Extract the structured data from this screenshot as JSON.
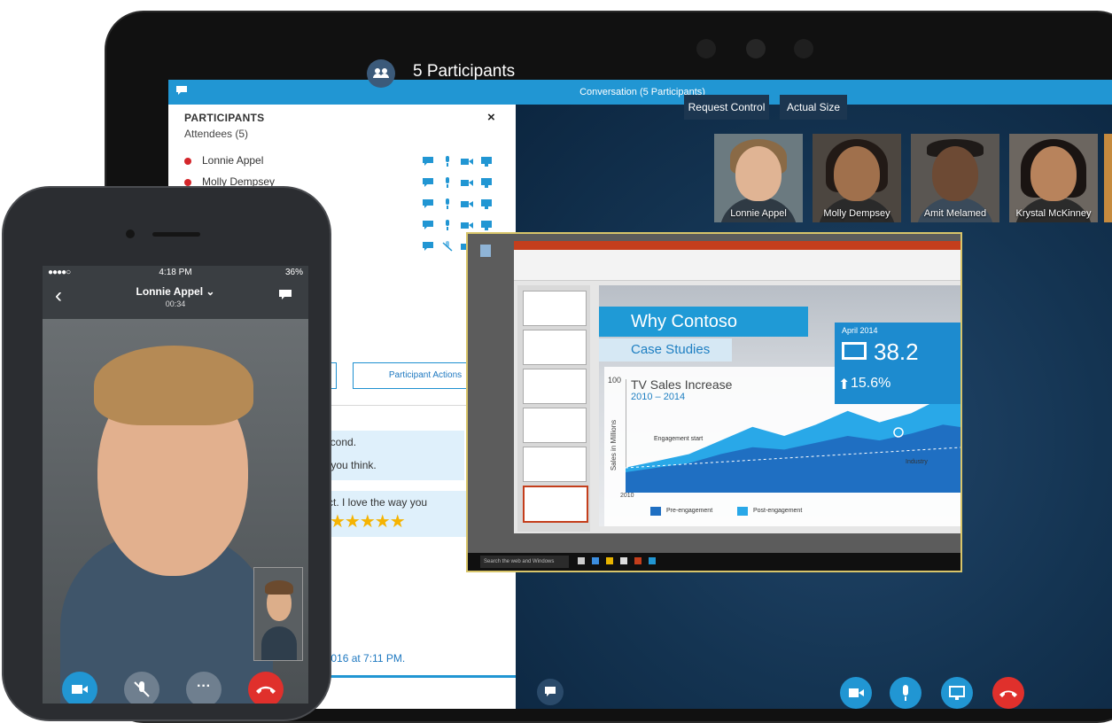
{
  "window": {
    "title": "Conversation (5 Participants)"
  },
  "left_panel": {
    "participants_header": "PARTICIPANTS",
    "attendees_label": "Attendees (5)",
    "close_symbol": "×",
    "participants": [
      {
        "name": "Lonnie Appel"
      },
      {
        "name": "Molly Dempsey"
      }
    ],
    "participant_actions_label": "Participant Actions"
  },
  "chat": {
    "close_symbol": "×",
    "messages": [
      {
        "lines": [
          "second.",
          "at you think."
        ]
      },
      {
        "lines": [
          "fect. I love the way you",
          "t."
        ],
        "stars": "★★★★★"
      }
    ],
    "date_line": "23/2016 at 7:11 PM."
  },
  "stage": {
    "title": "5 Participants",
    "request_control_label": "Request Control",
    "actual_size_label": "Actual Size",
    "tiles": [
      {
        "name": "Lonnie Appel"
      },
      {
        "name": "Molly Dempsey"
      },
      {
        "name": "Amit Melamed"
      },
      {
        "name": "Krystal McKinney"
      }
    ]
  },
  "shared_slide": {
    "title": "Why Contoso",
    "subtitle": "Case Studies",
    "stat_date": "April 2014",
    "stat_value": "38.2",
    "stat_percent": "15.6%",
    "taskbar_search": "Search the web and Windows"
  },
  "chart_data": {
    "type": "area",
    "title": "TV Sales Increase",
    "subtitle": "2010 – 2014",
    "ylabel": "Sales in Millions",
    "ylim": [
      0,
      100
    ],
    "y_tick_top": "100",
    "x_first_label": "2010",
    "annotation": "Engagement start",
    "series": [
      {
        "name": "Pre-engagement",
        "values": [
          18,
          22,
          26,
          34,
          40,
          38,
          44,
          50,
          46,
          52,
          60,
          56
        ]
      },
      {
        "name": "Post-engagement",
        "values": [
          22,
          28,
          34,
          46,
          58,
          50,
          60,
          72,
          62,
          70,
          84,
          76
        ]
      }
    ],
    "legend": [
      "Pre-engagement",
      "Post-engagement"
    ]
  },
  "phone": {
    "time": "4:18 PM",
    "signal": "●●●●○",
    "battery": "36%",
    "caller_name": "Lonnie Appel ⌄",
    "duration": "00:34",
    "back_symbol": "‹",
    "more_symbol": "···"
  },
  "colors": {
    "accent": "#2196d3",
    "end_call": "#e0302c",
    "presence_busy": "#d4262b",
    "stage_dark": "#0e2a45"
  }
}
